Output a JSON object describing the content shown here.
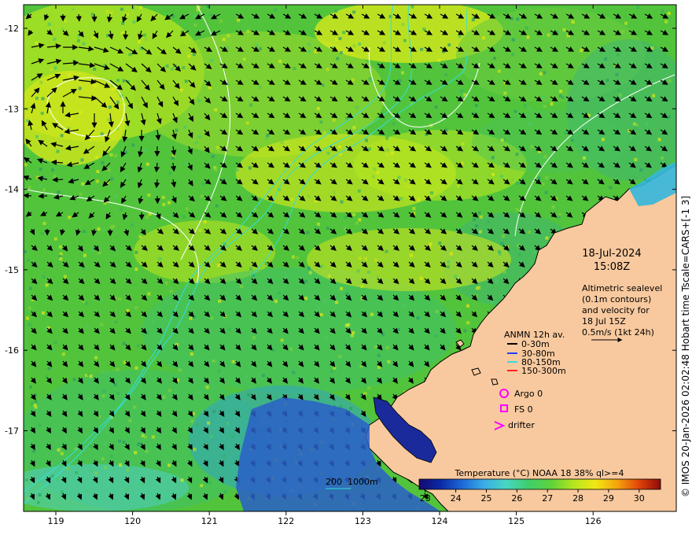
{
  "map": {
    "date": "18-Jul-2024",
    "time": "15:08Z",
    "altimetry_note": [
      "Altimetric sealevel",
      "(0.1m contours)",
      "and velocity for",
      "18 Jul 15Z"
    ],
    "velocity_scale": "0.5m/s (1kt 24h)",
    "credit": "© IMOS 20-Jan-2026 02:02:48 Hobart time Tscale=CARS+[-1 3]",
    "lon_ticks": [
      "119",
      "120",
      "121",
      "122",
      "123",
      "124",
      "125",
      "126"
    ],
    "lat_ticks": [
      "-12",
      "-13",
      "-14",
      "-15",
      "-16",
      "-17"
    ],
    "lon_values": [
      119,
      120,
      121,
      122,
      123,
      124,
      125,
      126
    ],
    "lat_values": [
      -12,
      -13,
      -14,
      -15,
      -16,
      -17
    ]
  },
  "legend": {
    "title": "ANMN 12h av.",
    "items": [
      {
        "label": "0-30m",
        "color": "#000000"
      },
      {
        "label": "30-80m",
        "color": "#1f3fff"
      },
      {
        "label": "80-150m",
        "color": "#33dddd"
      },
      {
        "label": "150-300m",
        "color": "#ff2222"
      }
    ],
    "argo_label": "Argo 0",
    "fs_label": "FS 0",
    "drifter_label": "drifter",
    "marker_color": "#ff00ff"
  },
  "bathymetry": {
    "label": "200  1000m",
    "color": "#33dddd"
  },
  "colorbar": {
    "title": "Temperature (°C) NOAA 18 38% ql>=4",
    "ticks": [
      "23",
      "24",
      "25",
      "26",
      "27",
      "28",
      "29",
      "30"
    ],
    "tick_values": [
      23,
      24,
      25,
      26,
      27,
      28,
      29,
      30
    ],
    "range": [
      22.8,
      30.7
    ],
    "colors": [
      "#150a6e",
      "#0b2aa6",
      "#1e6ad6",
      "#3aaee6",
      "#48d6c4",
      "#3fce6c",
      "#5fd33a",
      "#b6e61e",
      "#f2e814",
      "#f4a40c",
      "#e2440a",
      "#8c0a0a"
    ]
  },
  "land_color": "#f8c99e"
}
